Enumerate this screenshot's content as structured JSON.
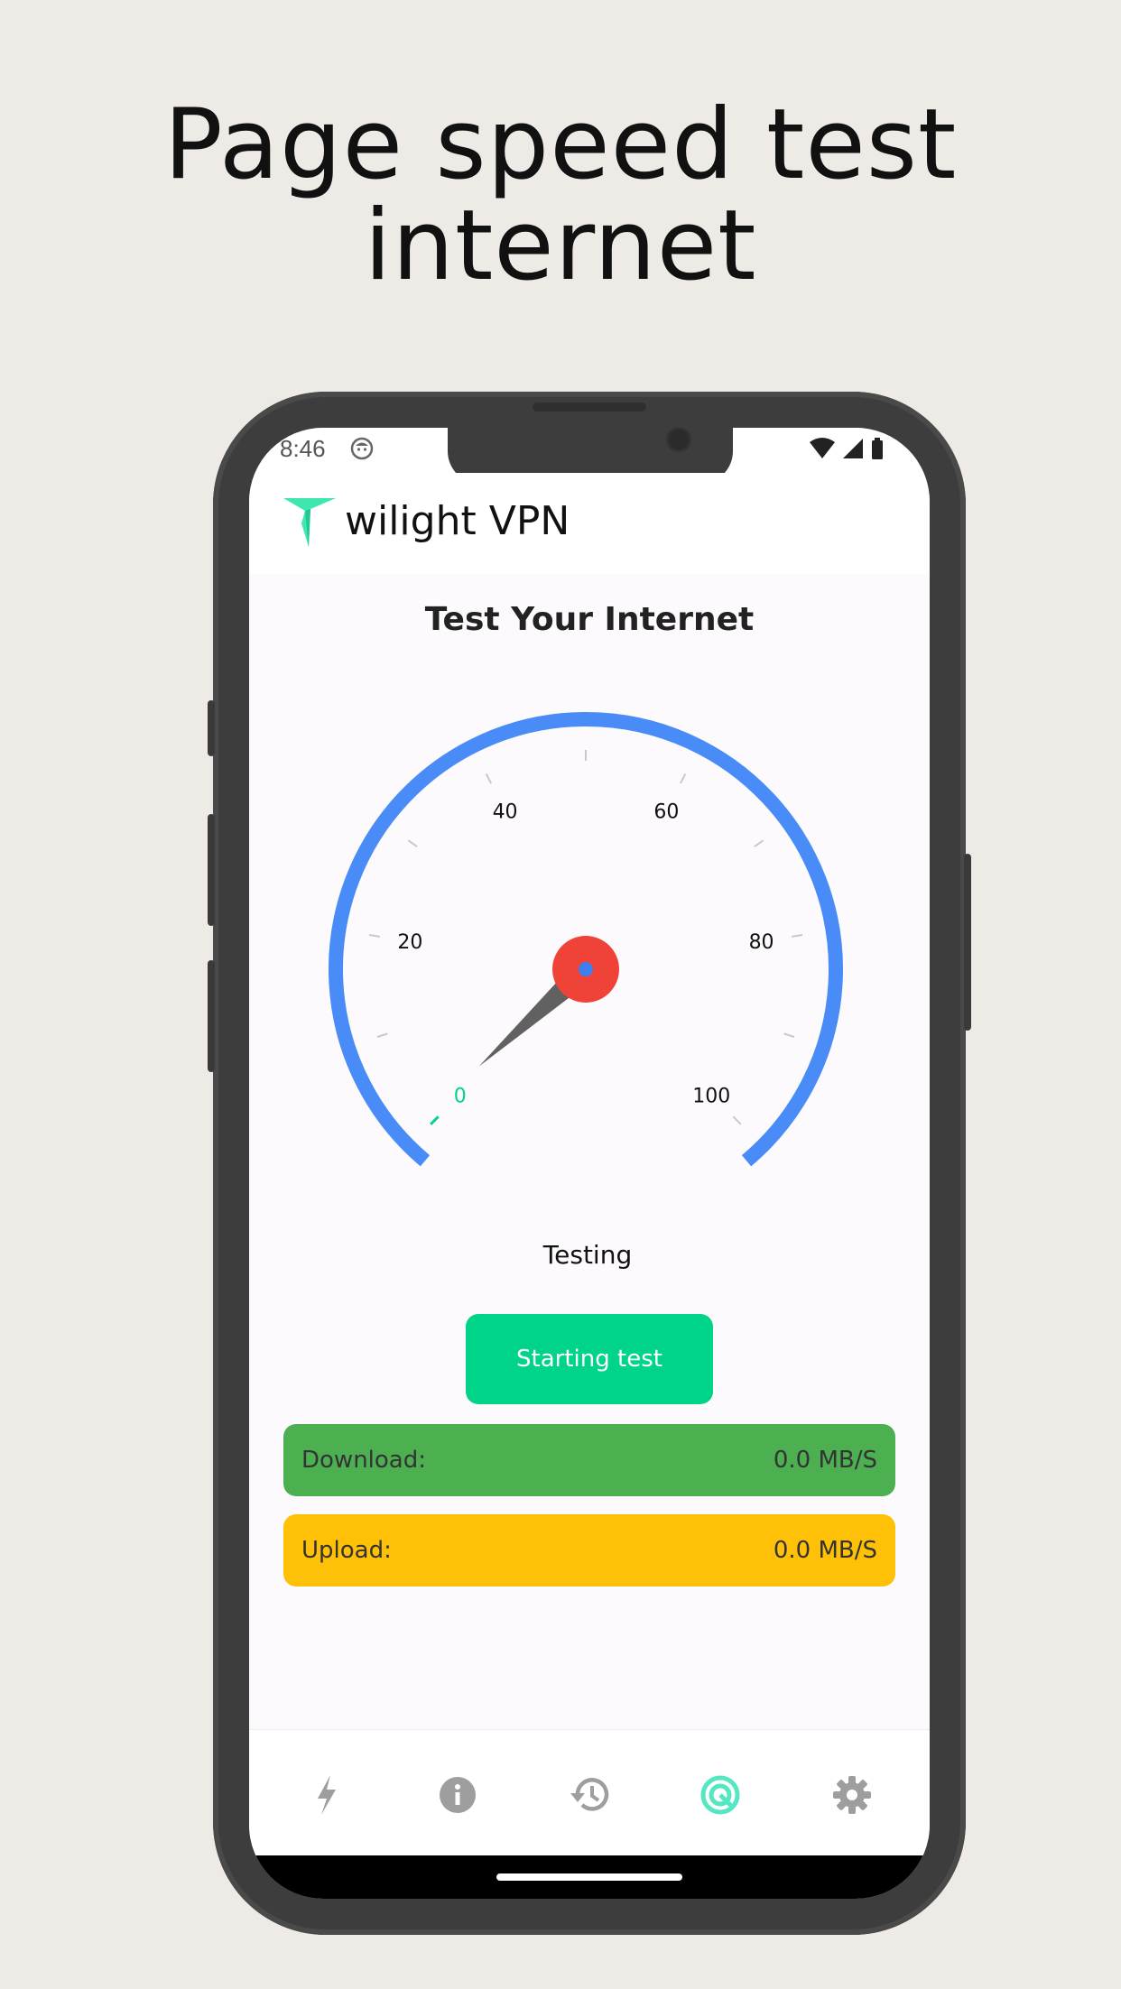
{
  "headline": "Page speed test internet",
  "status_bar": {
    "time": "8:46"
  },
  "app": {
    "name": "wilight VPN",
    "accent_color": "#00d488",
    "logo_color": "#3ee6b0"
  },
  "screen_title": "Test Your Internet",
  "gauge": {
    "tick_labels": [
      "0",
      "20",
      "40",
      "60",
      "80",
      "100"
    ],
    "min": 0,
    "max": 100,
    "needle_value": 1,
    "arc_color": "#4a8cf7",
    "hub_color": "#f04338",
    "needle_color": "#616161",
    "zero_label_color": "#00d488"
  },
  "status_text": "Testing",
  "start_button_label": "Starting test",
  "results": {
    "download_label": "Download:",
    "download_value": "0.0 MB/S",
    "download_color": "#4caf50",
    "upload_label": "Upload:",
    "upload_value": "0.0 MB/S",
    "upload_color": "#ffc107"
  },
  "bottom_nav": {
    "items": [
      {
        "icon": "bolt-icon",
        "active": false
      },
      {
        "icon": "info-icon",
        "active": false
      },
      {
        "icon": "history-icon",
        "active": false
      },
      {
        "icon": "speed-test-icon",
        "active": true
      },
      {
        "icon": "gear-icon",
        "active": false
      }
    ],
    "active_color": "#55e6c2",
    "inactive_color": "#9e9e9e"
  }
}
